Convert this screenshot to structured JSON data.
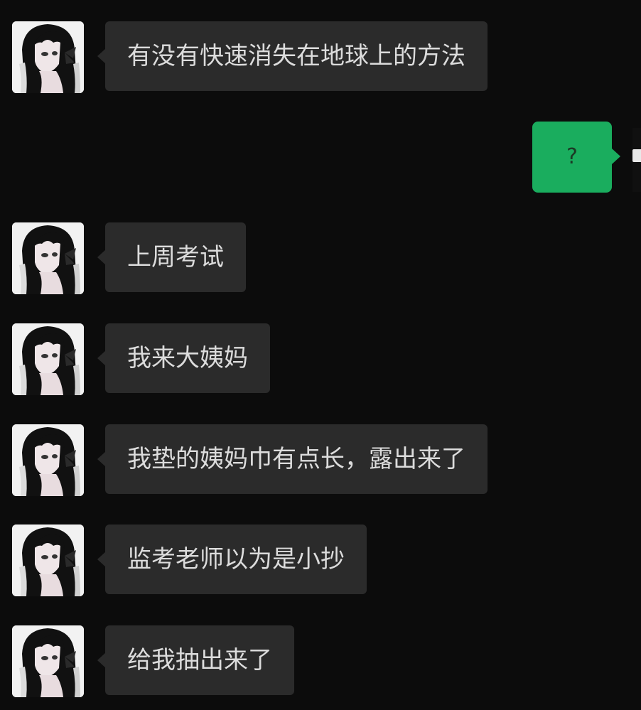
{
  "messages": [
    {
      "sender": "contact",
      "text": "有没有快速消失在地球上的方法"
    },
    {
      "sender": "me",
      "text": "?"
    },
    {
      "sender": "contact",
      "text": "上周考试"
    },
    {
      "sender": "contact",
      "text": "我来大姨妈"
    },
    {
      "sender": "contact",
      "text": "我垫的姨妈巾有点长，露出来了"
    },
    {
      "sender": "contact",
      "text": "监考老师以为是小抄"
    },
    {
      "sender": "contact",
      "text": "给我抽出来了"
    }
  ],
  "colors": {
    "background": "#0c0c0c",
    "incoming_bubble": "#2b2b2b",
    "incoming_text": "#dcdcdc",
    "outgoing_bubble": "#1aad5e"
  },
  "icons": {
    "contact_avatar": "anime-girl-avatar"
  }
}
